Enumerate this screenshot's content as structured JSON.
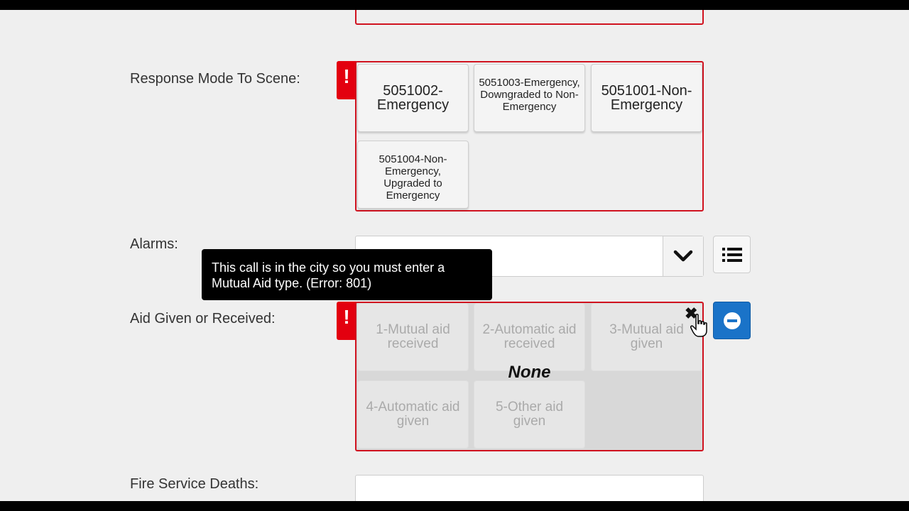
{
  "response_mode": {
    "label": "Response Mode To Scene:",
    "error_flag": "!",
    "options": [
      {
        "label": "5051002-Emergency"
      },
      {
        "label": "5051003-Emergency, Downgraded to Non-Emergency"
      },
      {
        "label": "5051001-Non-Emergency"
      },
      {
        "label": "5051004-Non-Emergency, Upgraded to Emergency"
      }
    ]
  },
  "alarms": {
    "label": "Alarms:",
    "value": "",
    "dropdown_icon": "chevron-down-icon",
    "list_icon": "list-icon"
  },
  "tooltip": {
    "text": "This call is in the city so you must enter a Mutual Aid type. (Error: 801)"
  },
  "aid": {
    "label": "Aid Given or Received:",
    "error_flag": "!",
    "selected": "None",
    "clear_icon": "close-icon",
    "remove_icon": "minus-circle-icon",
    "options": [
      {
        "label": "1-Mutual aid received"
      },
      {
        "label": "2-Automatic aid received"
      },
      {
        "label": "3-Mutual aid given"
      },
      {
        "label": "4-Automatic aid given"
      },
      {
        "label": "5-Other aid given"
      }
    ]
  },
  "fire_deaths": {
    "label": "Fire Service Deaths:",
    "value": ""
  },
  "colors": {
    "error_red": "#e3000f",
    "accent_blue": "#1a73c8"
  }
}
